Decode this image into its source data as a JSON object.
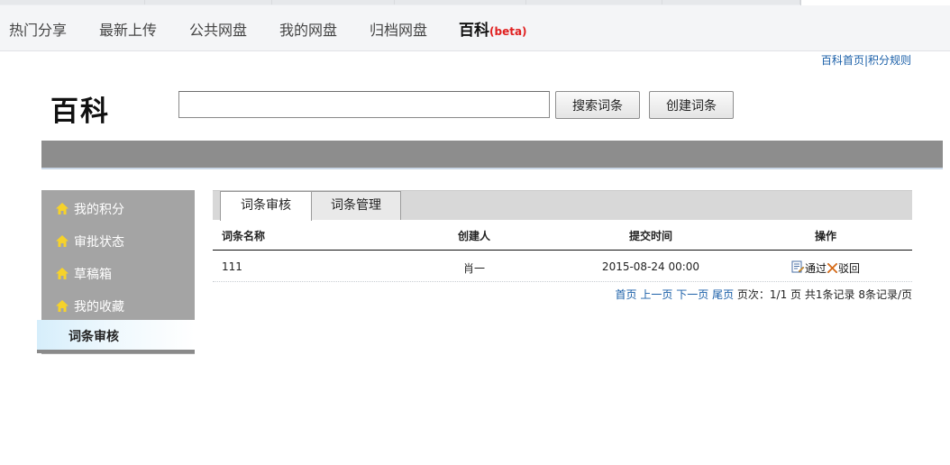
{
  "topnav": {
    "items": [
      {
        "label": "热门分享"
      },
      {
        "label": "最新上传"
      },
      {
        "label": "公共网盘"
      },
      {
        "label": "我的网盘"
      },
      {
        "label": "归档网盘"
      }
    ],
    "current": {
      "label": "百科",
      "badge": "(beta)"
    }
  },
  "toplinks": {
    "home": "百科首页",
    "sep": "|",
    "rules": "积分规则"
  },
  "logo": {
    "text": "百科"
  },
  "search": {
    "value": "",
    "search_button": "搜索词条",
    "create_button": "创建词条"
  },
  "sidebar": {
    "items": [
      {
        "label": "我的积分",
        "icon": "home-icon"
      },
      {
        "label": "审批状态",
        "icon": "home-icon"
      },
      {
        "label": "草稿箱",
        "icon": "home-icon"
      },
      {
        "label": "我的收藏",
        "icon": "home-icon"
      }
    ],
    "active": "词条审核"
  },
  "tabs": [
    {
      "label": "词条审核",
      "active": true
    },
    {
      "label": "词条管理",
      "active": false
    }
  ],
  "table": {
    "headers": [
      "词条名称",
      "创建人",
      "提交时间",
      "操作"
    ],
    "rows": [
      {
        "name": "111",
        "creator": "肖一",
        "time": "2015-08-24 00:00",
        "approve": "通过",
        "reject": "驳回"
      }
    ]
  },
  "pager": {
    "first": "首页",
    "prev": "上一页",
    "next": "下一页",
    "last": "尾页",
    "info": "页次：1/1 页 共1条记录 8条记录/页"
  },
  "colors": {
    "accent_link": "#1a5fa8",
    "beta_badge": "#e02020",
    "sidebar_bg": "#a4a4a4",
    "home_icon": "#f6d22a"
  }
}
